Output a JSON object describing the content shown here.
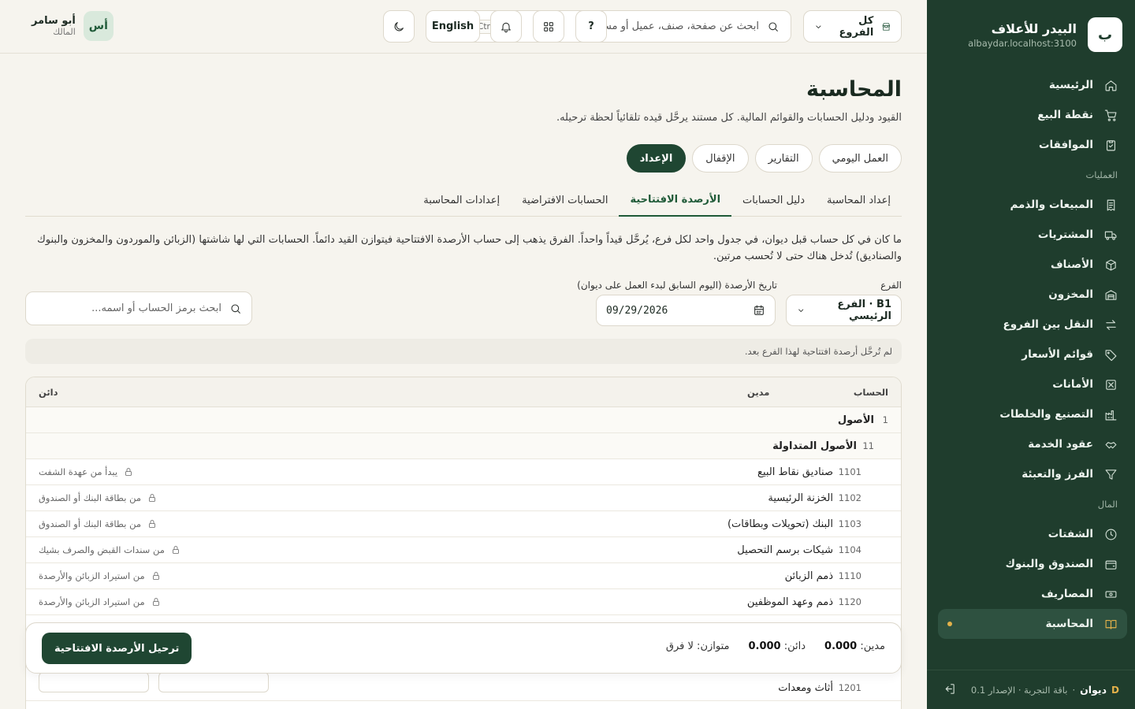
{
  "brand": {
    "logo_letter": "ب",
    "name": "البيدر للأعلاف",
    "host": "albaydar.localhost:3100"
  },
  "sidebar": {
    "top_items": [
      {
        "label": "الرئيسية",
        "icon": "home-icon"
      },
      {
        "label": "نقطة البيع",
        "icon": "cart-icon"
      },
      {
        "label": "الموافقات",
        "icon": "clipboard-check-icon"
      }
    ],
    "section_operations": "العمليات",
    "operations_items": [
      {
        "label": "المبيعات والذمم",
        "icon": "receipt-icon"
      },
      {
        "label": "المشتريات",
        "icon": "truck-icon"
      },
      {
        "label": "الأصناف",
        "icon": "box-icon"
      },
      {
        "label": "المخزون",
        "icon": "warehouse-icon"
      },
      {
        "label": "النقل بين الفروع",
        "icon": "transfer-icon"
      },
      {
        "label": "قوائم الأسعار",
        "icon": "tag-icon"
      },
      {
        "label": "الأمانات",
        "icon": "consignment-icon"
      },
      {
        "label": "التصنيع والخلطات",
        "icon": "factory-icon"
      },
      {
        "label": "عقود الخدمة",
        "icon": "handshake-icon"
      },
      {
        "label": "الفرز والتعبئة",
        "icon": "filter-icon"
      }
    ],
    "section_money": "المال",
    "money_items": [
      {
        "label": "الشفتات",
        "icon": "clock-icon"
      },
      {
        "label": "الصندوق والبنوك",
        "icon": "wallet-icon"
      },
      {
        "label": "المصاريف",
        "icon": "banknote-icon"
      },
      {
        "label": "المحاسبة",
        "icon": "book-icon",
        "active": true
      }
    ],
    "footer": {
      "app": "ديوان",
      "version": "باقة التجربة · الإصدار 0.1",
      "separator": "·"
    }
  },
  "topbar": {
    "branch_select": "كل الفروع",
    "search_placeholder": "ابحث عن صفحة، صنف، عميل أو مستند...",
    "search_shortcut": "Ctrl K",
    "help_label": "?",
    "language_label": "English",
    "user": {
      "name": "أبو سامر",
      "role": "المالك",
      "initials": "أس"
    }
  },
  "page": {
    "title": "المحاسبة",
    "subtitle": "القيود ودليل الحسابات والقوائم المالية. كل مستند يرحَّل قيده تلقائياً لحظة ترحيله.",
    "pills": [
      "العمل اليومي",
      "التقارير",
      "الإقفال",
      "الإعداد"
    ],
    "active_pill": 3,
    "subtabs": [
      "إعداد المحاسبة",
      "دليل الحسابات",
      "الأرصدة الافتتاحية",
      "الحسابات الافتراضية",
      "إعدادات المحاسبة"
    ],
    "active_subtab": 2,
    "intro": "ما كان في كل حساب قبل ديوان، في جدول واحد لكل فرع، يُرحَّل قيداً واحداً. الفرق يذهب إلى حساب الأرصدة الافتتاحية فيتوازن القيد دائماً. الحسابات التي لها شاشتها (الزبائن والموردون والمخزون والبنوك والصناديق) تُدخل هناك حتى لا تُحسب مرتين.",
    "branch_label": "الفرع",
    "branch_value": "B1 · الفرع الرئيسي",
    "date_label": "تاريخ الأرصدة (اليوم السابق لبدء العمل على ديوان)",
    "date_value": "09/29/2026",
    "account_search_placeholder": "ابحث برمز الحساب أو اسمه...",
    "notice": "لم تُرحَّل أرصدة افتتاحية لهذا الفرع بعد."
  },
  "table": {
    "headers": {
      "account": "الحساب",
      "debit": "مدين",
      "credit": "دائن"
    },
    "groups": [
      {
        "code": "1",
        "name": "الأصول"
      },
      {
        "code": "11",
        "name": "الأصول المتداولة"
      }
    ],
    "rows": [
      {
        "code": "1101",
        "name": "صناديق نقاط البيع",
        "note": "يبدأ من عهدة الشفت"
      },
      {
        "code": "1102",
        "name": "الخزنة الرئيسية",
        "note": "من بطاقة البنك أو الصندوق"
      },
      {
        "code": "1103",
        "name": "البنك (تحويلات وبطاقات)",
        "note": "من بطاقة البنك أو الصندوق"
      },
      {
        "code": "1104",
        "name": "شيكات برسم التحصيل",
        "note": "من سندات القبض والصرف بشيك"
      },
      {
        "code": "1110",
        "name": "ذمم الزبائن",
        "note": "من استيراد الزبائن والأرصدة"
      },
      {
        "code": "1120",
        "name": "ذمم وعهد الموظفين",
        "note": "من استيراد الزبائن والأرصدة"
      }
    ],
    "tail_row": {
      "code": "1201",
      "name": "أثاث ومعدات"
    }
  },
  "summary": {
    "debit_label": "مدين:",
    "debit_value": "0.000",
    "credit_label": "دائن:",
    "credit_value": "0.000",
    "balanced": "متوازن: لا فرق",
    "post_button": "ترحيل الأرصدة الافتتاحية"
  },
  "colors": {
    "sidebar": "#1f3d2d",
    "accent": "#1f4632",
    "highlight": "#e3b14a",
    "background": "#f6f4ee"
  }
}
